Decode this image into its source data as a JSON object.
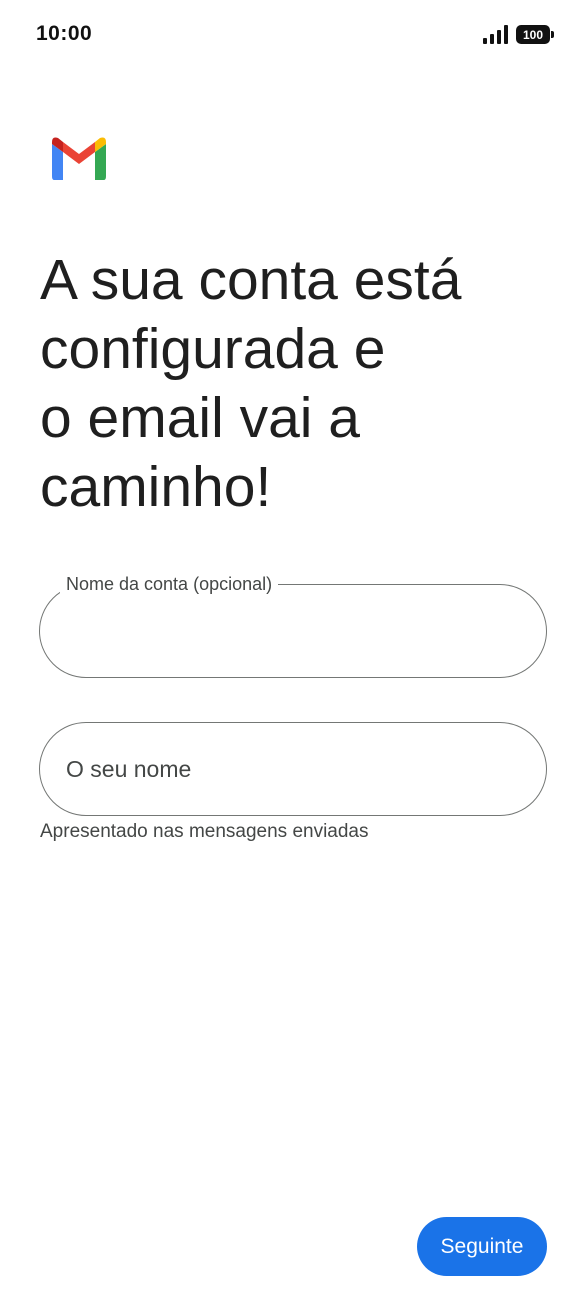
{
  "status_bar": {
    "time": "10:00",
    "battery": "100",
    "icons": [
      "signal-icon",
      "battery-icon"
    ]
  },
  "logo": {
    "icon": "gmail-logo-icon",
    "colors": [
      "#4285F4",
      "#EA4335",
      "#FBBC04",
      "#34A853",
      "#C5221F"
    ]
  },
  "heading": {
    "lines": [
      "A sua conta está",
      "configurada e",
      "o email vai a",
      "caminho!"
    ]
  },
  "form": {
    "account_name": {
      "label": "Nome da conta (opcional)",
      "value": ""
    },
    "your_name": {
      "placeholder": "O seu nome",
      "value": ""
    },
    "your_name_helper": "Apresentado nas mensagens enviadas"
  },
  "actions": {
    "next_label": "Seguinte",
    "next_color": "#1a73e8"
  }
}
